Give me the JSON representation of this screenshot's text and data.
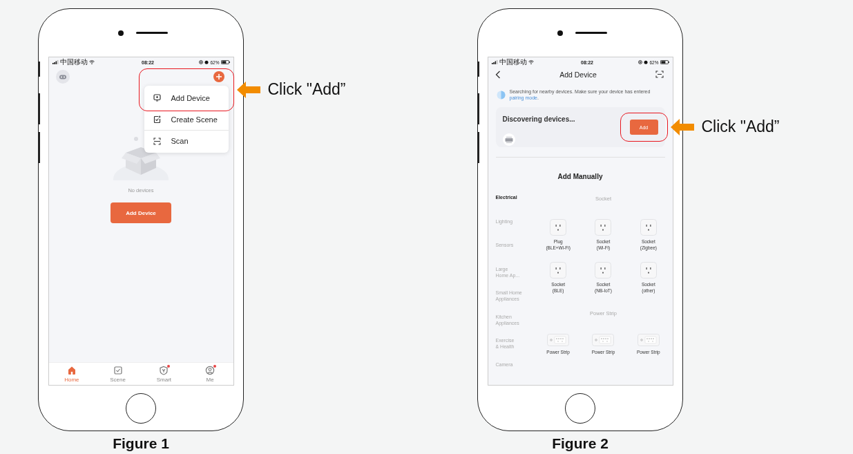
{
  "figures": [
    {
      "kind": "home",
      "caption": "Figure 1",
      "callout": "Click \"Add”",
      "status_bar": {
        "carrier": "中国移动",
        "time": "08:22",
        "battery": "62%"
      },
      "menu": [
        {
          "label": "Add Device",
          "highlighted": true
        },
        {
          "label": "Create Scene",
          "highlighted": false
        },
        {
          "label": "Scan",
          "highlighted": false
        }
      ],
      "empty_text": "No devices",
      "add_button": "Add Device",
      "tabs": [
        {
          "label": "Home",
          "selected": true,
          "badge": false
        },
        {
          "label": "Scene",
          "selected": false,
          "badge": false
        },
        {
          "label": "Smart",
          "selected": false,
          "badge": true
        },
        {
          "label": "Me",
          "selected": false,
          "badge": true
        }
      ]
    },
    {
      "kind": "add_device",
      "caption": "Figure 2",
      "callout": "Click \"Add”",
      "status_bar": {
        "carrier": "中国移动",
        "time": "08:22",
        "battery": "62%"
      },
      "title": "Add Device",
      "notice": "Searching for nearby devices. Make sure your device has entered ",
      "notice_link": "pairing mode",
      "notice_end": ".",
      "discovery": {
        "title": "Discovering devices...",
        "button": "Add",
        "highlighted": true
      },
      "manual_title": "Add Manually",
      "categories": [
        {
          "label": "Electrical",
          "selected": true
        },
        {
          "label": "Lighting",
          "selected": false
        },
        {
          "label": "Sensors",
          "selected": false
        },
        {
          "label": "Large\nHome Ap...",
          "selected": false
        },
        {
          "label": "Small Home\nAppliances",
          "selected": false
        },
        {
          "label": "Kitchen\nAppliances",
          "selected": false
        },
        {
          "label": "Exercise\n& Health",
          "selected": false
        },
        {
          "label": "Camera",
          "selected": false
        }
      ],
      "sections": [
        {
          "title": "Socket",
          "items": [
            {
              "kind": "socket",
              "label": "Plug\n(BLE+Wi-Fi)"
            },
            {
              "kind": "socket",
              "label": "Socket\n(Wi-Fi)"
            },
            {
              "kind": "socket",
              "label": "Socket\n(Zigbee)"
            },
            {
              "kind": "socket",
              "label": "Socket\n(BLE)"
            },
            {
              "kind": "socket",
              "label": "Socket\n(NB-IoT)"
            },
            {
              "kind": "socket",
              "label": "Socket\n(other)"
            }
          ]
        },
        {
          "title": "Power Strip",
          "items": [
            {
              "kind": "power_strip",
              "label": "Power Strip"
            },
            {
              "kind": "power_strip",
              "label": "Power Strip"
            },
            {
              "kind": "power_strip",
              "label": "Power Strip"
            }
          ]
        }
      ]
    }
  ]
}
